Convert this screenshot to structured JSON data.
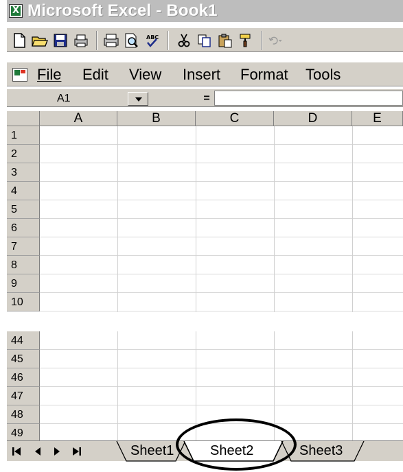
{
  "window": {
    "title": "Microsoft Excel - Book1",
    "app_icon_glyph": "X"
  },
  "toolbar": {
    "buttons": [
      {
        "name": "new-icon"
      },
      {
        "name": "open-folder-icon"
      },
      {
        "name": "save-icon"
      },
      {
        "name": "print-preview-icon"
      },
      {
        "name": "print-icon"
      },
      {
        "name": "preview-magnifier-icon"
      },
      {
        "name": "spelling-icon"
      },
      {
        "name": "cut-icon"
      },
      {
        "name": "copy-icon"
      },
      {
        "name": "paste-icon"
      },
      {
        "name": "format-painter-icon"
      },
      {
        "name": "undo-icon"
      }
    ]
  },
  "menu": {
    "items": [
      {
        "label": "File"
      },
      {
        "label": "Edit"
      },
      {
        "label": "View"
      },
      {
        "label": "Insert"
      },
      {
        "label": "Format"
      },
      {
        "label": "Tools"
      }
    ]
  },
  "formula_bar": {
    "name_box": "A1",
    "equals": "=",
    "value": ""
  },
  "grid": {
    "columns": [
      "A",
      "B",
      "C",
      "D",
      "E"
    ],
    "rows_top": [
      "1",
      "2",
      "3",
      "4",
      "5",
      "6",
      "7",
      "8",
      "9",
      "10"
    ],
    "rows_bottom": [
      "44",
      "45",
      "46",
      "47",
      "48",
      "49"
    ]
  },
  "sheets": {
    "tabs": [
      {
        "label": "Sheet1"
      },
      {
        "label": "Sheet2"
      },
      {
        "label": "Sheet3"
      }
    ],
    "active": "Sheet2"
  },
  "colors": {
    "excel_green": "#1f7a3a",
    "chrome_gray": "#d4d0c8",
    "title_gray": "#bdbdbd"
  }
}
